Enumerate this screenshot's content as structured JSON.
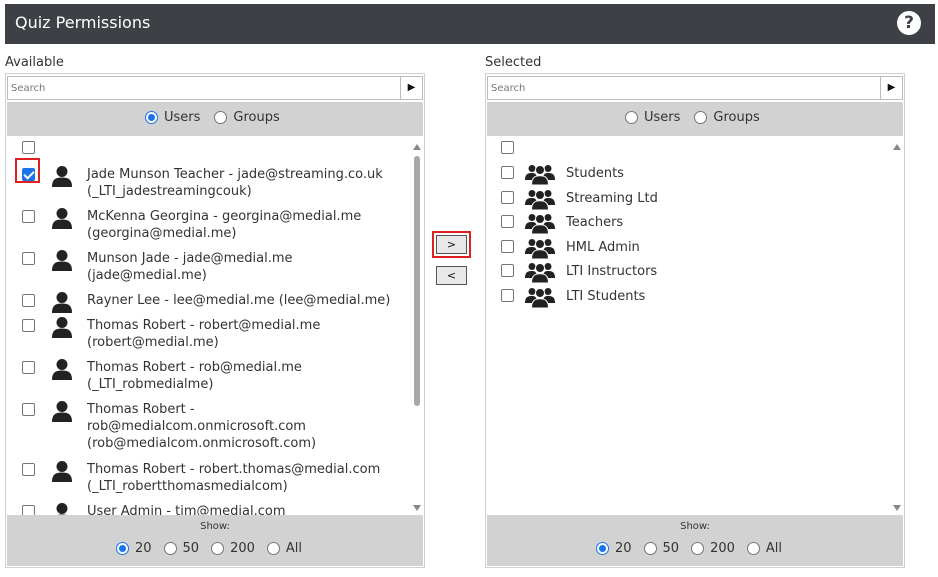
{
  "header": {
    "title": "Quiz Permissions",
    "help_icon": "question-circle-icon",
    "background": "#3d4045"
  },
  "available": {
    "label": "Available",
    "search_placeholder": "Search",
    "search_go": "▶",
    "type_options": [
      {
        "label": "Users",
        "selected": true
      },
      {
        "label": "Groups",
        "selected": false
      }
    ],
    "items": [
      {
        "lines": [
          "Jade Munson Teacher - jade@streaming.co.uk",
          "(_LTI_jadestreamingcouk)"
        ],
        "checked": true,
        "icon": "user-icon"
      },
      {
        "lines": [
          "McKenna Georgina - georgina@medial.me",
          "(georgina@medial.me)"
        ],
        "checked": false,
        "icon": "user-icon"
      },
      {
        "lines": [
          "Munson Jade - jade@medial.me",
          "(jade@medial.me)"
        ],
        "checked": false,
        "icon": "user-icon"
      },
      {
        "lines": [
          "Rayner Lee - lee@medial.me (lee@medial.me)"
        ],
        "checked": false,
        "icon": "user-icon"
      },
      {
        "lines": [
          "Thomas Robert - robert@medial.me",
          "(robert@medial.me)"
        ],
        "checked": false,
        "icon": "user-icon"
      },
      {
        "lines": [
          "Thomas Robert - rob@medial.me",
          "(_LTI_robmedialme)"
        ],
        "checked": false,
        "icon": "user-icon"
      },
      {
        "lines": [
          "Thomas Robert -",
          "rob@medialcom.onmicrosoft.com",
          "(rob@medialcom.onmicrosoft.com)"
        ],
        "checked": false,
        "icon": "user-icon"
      },
      {
        "lines": [
          "Thomas Robert - robert.thomas@medial.com",
          "(_LTI_robertthomasmedialcom)"
        ],
        "checked": false,
        "icon": "user-icon"
      },
      {
        "lines": [
          "User Admin - tim@medial.com"
        ],
        "checked": false,
        "icon": "user-icon"
      }
    ],
    "show_label": "Show:",
    "show_options": [
      {
        "label": "20",
        "selected": true
      },
      {
        "label": "50",
        "selected": false
      },
      {
        "label": "200",
        "selected": false
      },
      {
        "label": "All",
        "selected": false
      }
    ]
  },
  "buttons": {
    "add": ">",
    "remove": "<"
  },
  "selected": {
    "label": "Selected",
    "search_placeholder": "Search",
    "search_go": "▶",
    "type_options": [
      {
        "label": "Users",
        "selected": false
      },
      {
        "label": "Groups",
        "selected": false
      }
    ],
    "groups": [
      {
        "label": "Students",
        "icon": "group-icon"
      },
      {
        "label": "Streaming Ltd",
        "icon": "group-icon"
      },
      {
        "label": "Teachers",
        "icon": "group-icon"
      },
      {
        "label": "HML Admin",
        "icon": "group-icon"
      },
      {
        "label": "LTI Instructors",
        "icon": "group-icon"
      },
      {
        "label": "LTI Students",
        "icon": "group-icon"
      }
    ],
    "show_label": "Show:",
    "show_options": [
      {
        "label": "20",
        "selected": true
      },
      {
        "label": "50",
        "selected": false
      },
      {
        "label": "200",
        "selected": false
      },
      {
        "label": "All",
        "selected": false
      }
    ]
  },
  "colors": {
    "accent": "#1a73e8",
    "highlight": "#e02020",
    "bar": "#d2d2d2"
  }
}
